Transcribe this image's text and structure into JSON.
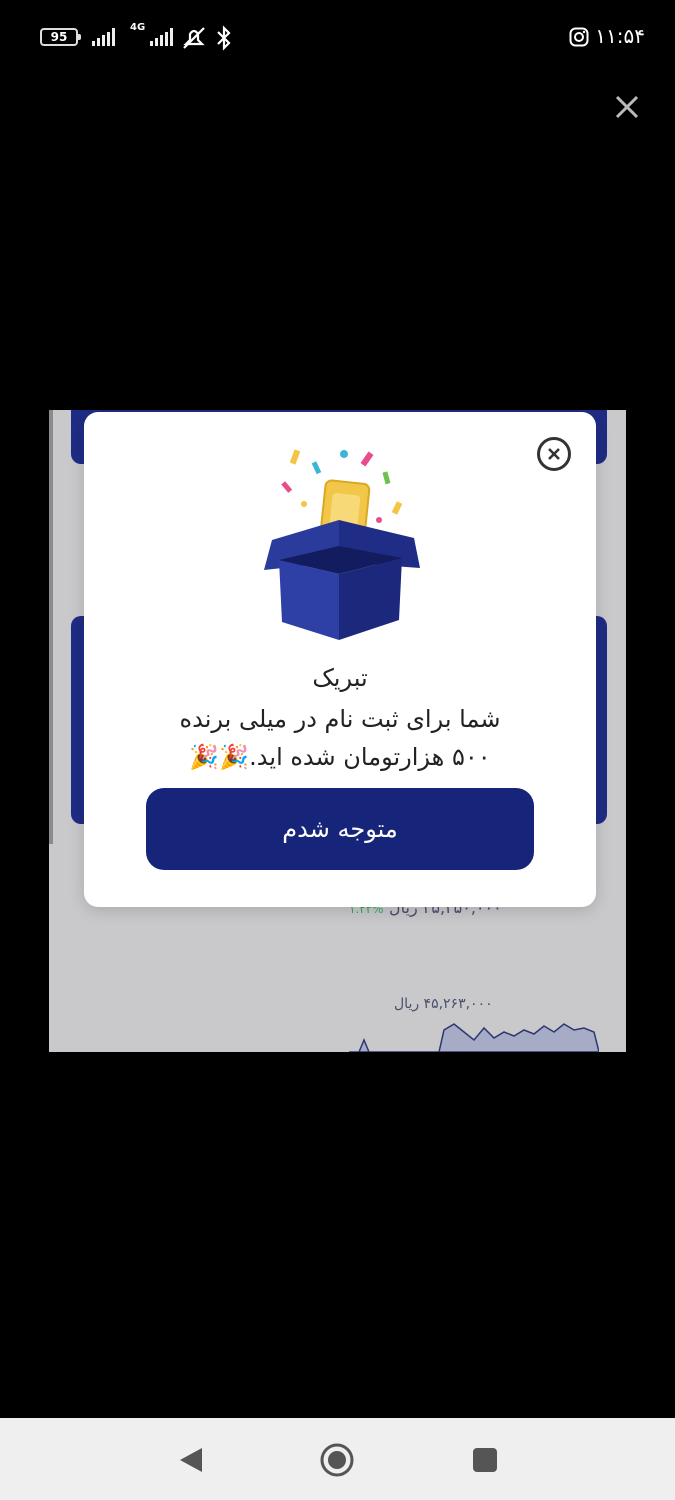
{
  "status_bar": {
    "battery_level": "95",
    "network_type": "4G",
    "time": "۱۱:۵۴"
  },
  "dialog": {
    "title": "تبریک",
    "message_line1": "شما برای ثبت نام در میلی برنده",
    "message_line2": "۵۰۰ هزارتومان شده اید.🎉🎉",
    "confirm_label": "متوجه شدم"
  },
  "background": {
    "price_text": "۴۵,۲۵۰,۰۰۰ ریال",
    "change_text": "۱.۲۲%",
    "chart_price_text": "۴۵,۲۶۳,۰۰۰ ریال"
  },
  "colors": {
    "accent": "#16257a",
    "background": "#000000",
    "dialog": "#ffffff",
    "nav_bar": "#efefef"
  },
  "icons": {
    "viewer_close": "close-icon",
    "dialog_close": "circle-close-icon",
    "nav_back": "back-triangle-icon",
    "nav_home": "home-circle-icon",
    "nav_recents": "recents-square-icon"
  }
}
